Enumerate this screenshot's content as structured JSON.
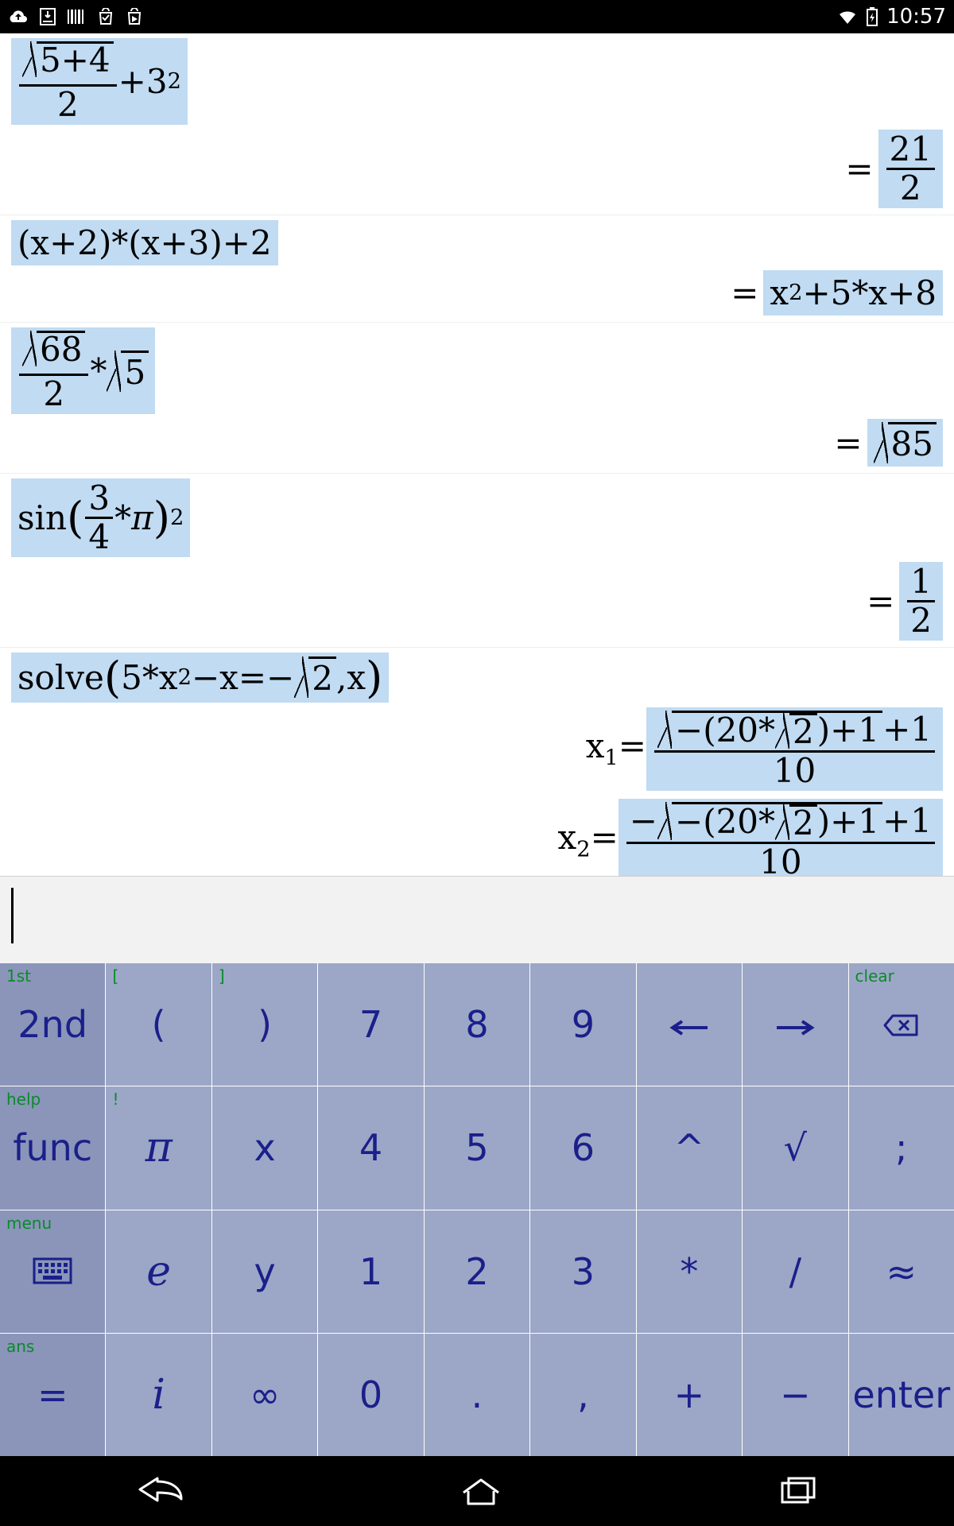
{
  "status": {
    "time": "10:57"
  },
  "history": [
    {
      "expr": {
        "type": "sum_sqrtfrac_plus_pow",
        "sqrt_num": "5+4",
        "frac_den": "2",
        "plus_base": "3",
        "plus_exp": "2"
      },
      "result": {
        "type": "frac",
        "num": "21",
        "den": "2"
      }
    },
    {
      "expr": {
        "type": "text",
        "text": "(x+2)*(x+3)+2"
      },
      "result": {
        "type": "poly",
        "text": "x",
        "exp": "2",
        "tail": "+5*x+8"
      }
    },
    {
      "expr": {
        "type": "sqrtfrac_times_sqrt",
        "sqrt_num": "68",
        "frac_den": "2",
        "right_rad": "5"
      },
      "result": {
        "type": "sqrt",
        "rad": "85"
      }
    },
    {
      "expr": {
        "type": "sin_pow",
        "inner_num": "3",
        "inner_den": "4",
        "inner_tail": "*π",
        "exp": "2",
        "fn": "sin"
      },
      "result": {
        "type": "frac",
        "num": "1",
        "den": "2"
      }
    },
    {
      "expr": {
        "type": "solve",
        "fn": "solve",
        "pre": "5*x",
        "exp": "2",
        "mid": "−x=−",
        "rad": "2",
        "post": ",x"
      },
      "results": [
        {
          "label_var": "x",
          "label_sub": "1",
          "neg_prefix": "",
          "rad_inner_pre": "−(20*",
          "rad_inner_rad": "2",
          "rad_inner_post": ")+1",
          "num_tail": "+1",
          "den": "10"
        },
        {
          "label_var": "x",
          "label_sub": "2",
          "neg_prefix": "−",
          "rad_inner_pre": "−(20*",
          "rad_inner_rad": "2",
          "rad_inner_post": ")+1",
          "num_tail": "+1",
          "den": "10"
        }
      ]
    }
  ],
  "input": {
    "value": ""
  },
  "keys": [
    [
      {
        "alt": "1st",
        "main": "2nd"
      },
      {
        "alt": "[",
        "main": "("
      },
      {
        "alt": "]",
        "main": ")"
      },
      {
        "alt": "",
        "main": "7"
      },
      {
        "alt": "",
        "main": "8"
      },
      {
        "alt": "",
        "main": "9"
      },
      {
        "alt": "",
        "main": "←",
        "arrow": "left"
      },
      {
        "alt": "",
        "main": "→",
        "arrow": "right"
      },
      {
        "alt": "clear",
        "main": "⌫",
        "bksp": true
      }
    ],
    [
      {
        "alt": "help",
        "main": "func"
      },
      {
        "alt": "!",
        "main": "π",
        "ital": true
      },
      {
        "alt": "",
        "main": "x"
      },
      {
        "alt": "",
        "main": "4"
      },
      {
        "alt": "",
        "main": "5"
      },
      {
        "alt": "",
        "main": "6"
      },
      {
        "alt": "",
        "main": "^"
      },
      {
        "alt": "",
        "main": "√"
      },
      {
        "alt": "",
        "main": ";"
      }
    ],
    [
      {
        "alt": "menu",
        "main": "⌨",
        "kbd": true
      },
      {
        "alt": "",
        "main": "e",
        "ital": true
      },
      {
        "alt": "",
        "main": "y"
      },
      {
        "alt": "",
        "main": "1"
      },
      {
        "alt": "",
        "main": "2"
      },
      {
        "alt": "",
        "main": "3"
      },
      {
        "alt": "",
        "main": "*"
      },
      {
        "alt": "",
        "main": "/"
      },
      {
        "alt": "",
        "main": "≈"
      }
    ],
    [
      {
        "alt": "ans",
        "main": "="
      },
      {
        "alt": "",
        "main": "i",
        "ital": true
      },
      {
        "alt": "",
        "main": "∞"
      },
      {
        "alt": "",
        "main": "0"
      },
      {
        "alt": "",
        "main": "."
      },
      {
        "alt": "",
        "main": ","
      },
      {
        "alt": "",
        "main": "+"
      },
      {
        "alt": "",
        "main": "−"
      },
      {
        "alt": "",
        "main": "enter"
      }
    ]
  ]
}
